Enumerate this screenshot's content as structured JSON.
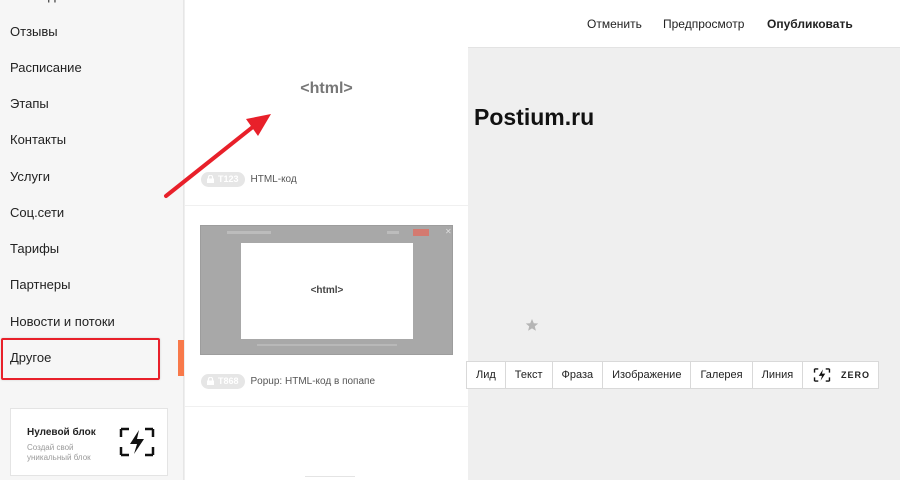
{
  "sidebar": {
    "items": [
      {
        "label": "Команда"
      },
      {
        "label": "Отзывы"
      },
      {
        "label": "Расписание"
      },
      {
        "label": "Этапы"
      },
      {
        "label": "Контакты"
      },
      {
        "label": "Услуги"
      },
      {
        "label": "Соц.сети"
      },
      {
        "label": "Тарифы"
      },
      {
        "label": "Партнеры"
      },
      {
        "label": "Новости и потоки"
      },
      {
        "label": "Другое"
      }
    ],
    "active_item": "Другое",
    "zero_card": {
      "title": "Нулевой блок",
      "subtitle": "Создай свой уникальный блок",
      "icon": "zero-block-icon"
    }
  },
  "block_list": {
    "preview_label": "<html>",
    "items": [
      {
        "code": "T123",
        "name": "HTML-код"
      },
      {
        "code": "T868",
        "name": "Popup: HTML-код в попапе",
        "thumb_label": "<html>"
      }
    ]
  },
  "topbar": {
    "cancel": "Отменить",
    "preview": "Предпросмотр",
    "publish": "Опубликовать"
  },
  "canvas": {
    "site_title": "Postium.ru",
    "star_icon": "star-icon"
  },
  "add_toolbar": {
    "buttons": [
      "Лид",
      "Текст",
      "Фраза",
      "Изображение",
      "Галерея",
      "Линия"
    ],
    "zero_label": "ZERO"
  },
  "colors": {
    "accent": "#f8794a",
    "annotation_red": "#e8202a"
  }
}
